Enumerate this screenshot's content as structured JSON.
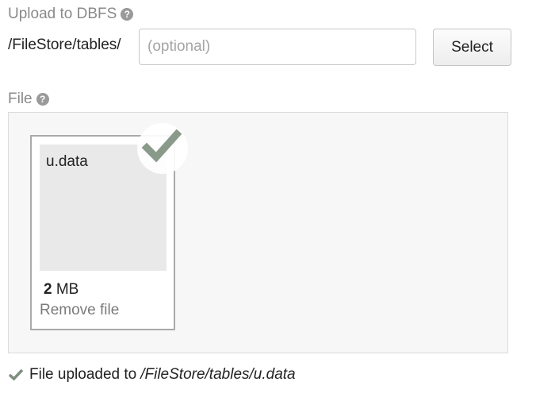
{
  "upload": {
    "label": "Upload to DBFS",
    "path_prefix": "/FileStore/tables/",
    "path_placeholder": "(optional)",
    "path_value": "",
    "select_label": "Select"
  },
  "file_section": {
    "label": "File"
  },
  "file_card": {
    "name": "u.data",
    "size_value": "2",
    "size_unit": "MB",
    "remove_label": "Remove file",
    "status_icon": "checkmark-icon"
  },
  "status": {
    "text": "File uploaded to",
    "path": "/FileStore/tables/u.data",
    "icon": "checkmark-icon"
  },
  "colors": {
    "check_green": "#8a9a8a",
    "muted_text": "#8a8a8a"
  }
}
